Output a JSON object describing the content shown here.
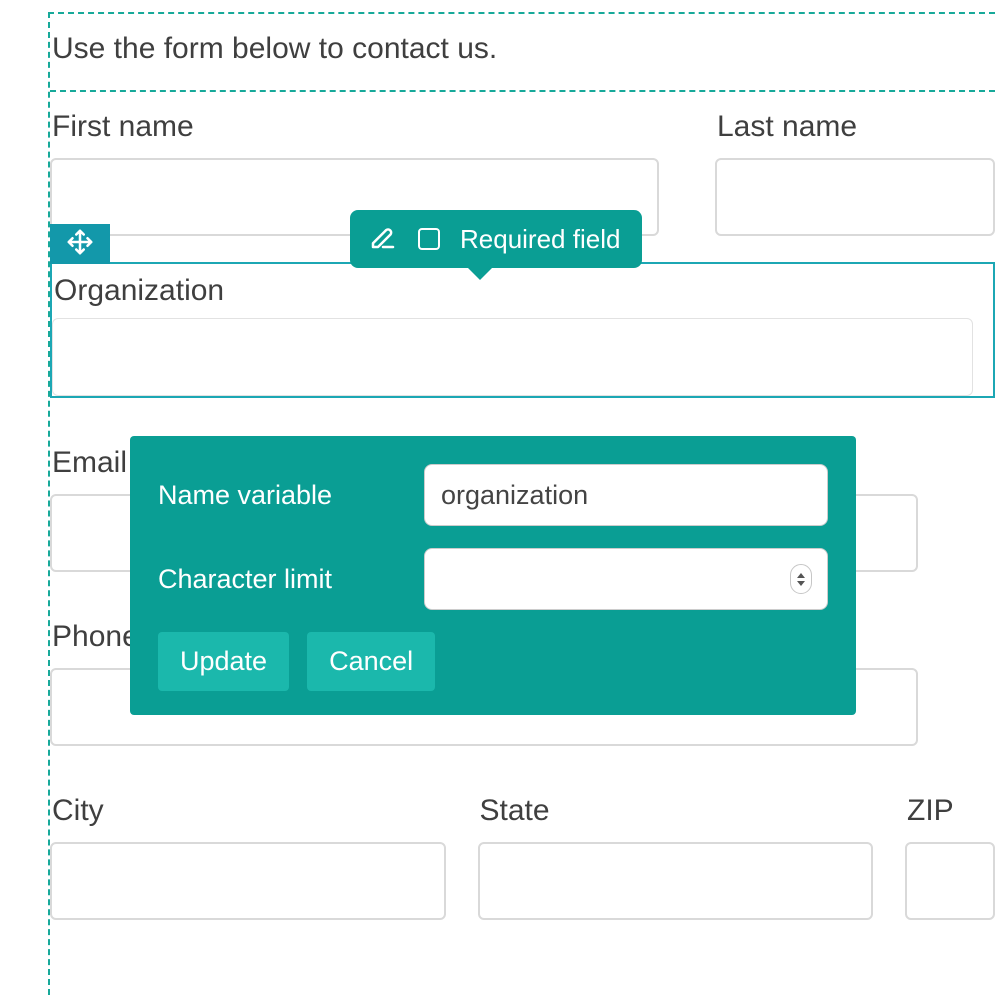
{
  "intro": "Use the form below to contact us.",
  "fields": {
    "first_name": {
      "label": "First name",
      "value": ""
    },
    "last_name": {
      "label": "Last name",
      "value": ""
    },
    "organization": {
      "label": "Organization",
      "value": ""
    },
    "email": {
      "label": "Email",
      "value": ""
    },
    "phone": {
      "label": "Phone",
      "value": ""
    },
    "city": {
      "label": "City",
      "value": ""
    },
    "state": {
      "label": "State",
      "value": ""
    },
    "zip": {
      "label": "ZIP",
      "value": ""
    }
  },
  "tooltip": {
    "required_label": "Required field",
    "required_checked": false
  },
  "popover": {
    "name_variable_label": "Name variable",
    "name_variable_value": "organization",
    "char_limit_label": "Character limit",
    "char_limit_value": "",
    "update_label": "Update",
    "cancel_label": "Cancel"
  },
  "colors": {
    "teal": "#0a9e94",
    "teal_light": "#1bb8ac",
    "handle": "#1398aa",
    "dashed": "#17a99a"
  }
}
